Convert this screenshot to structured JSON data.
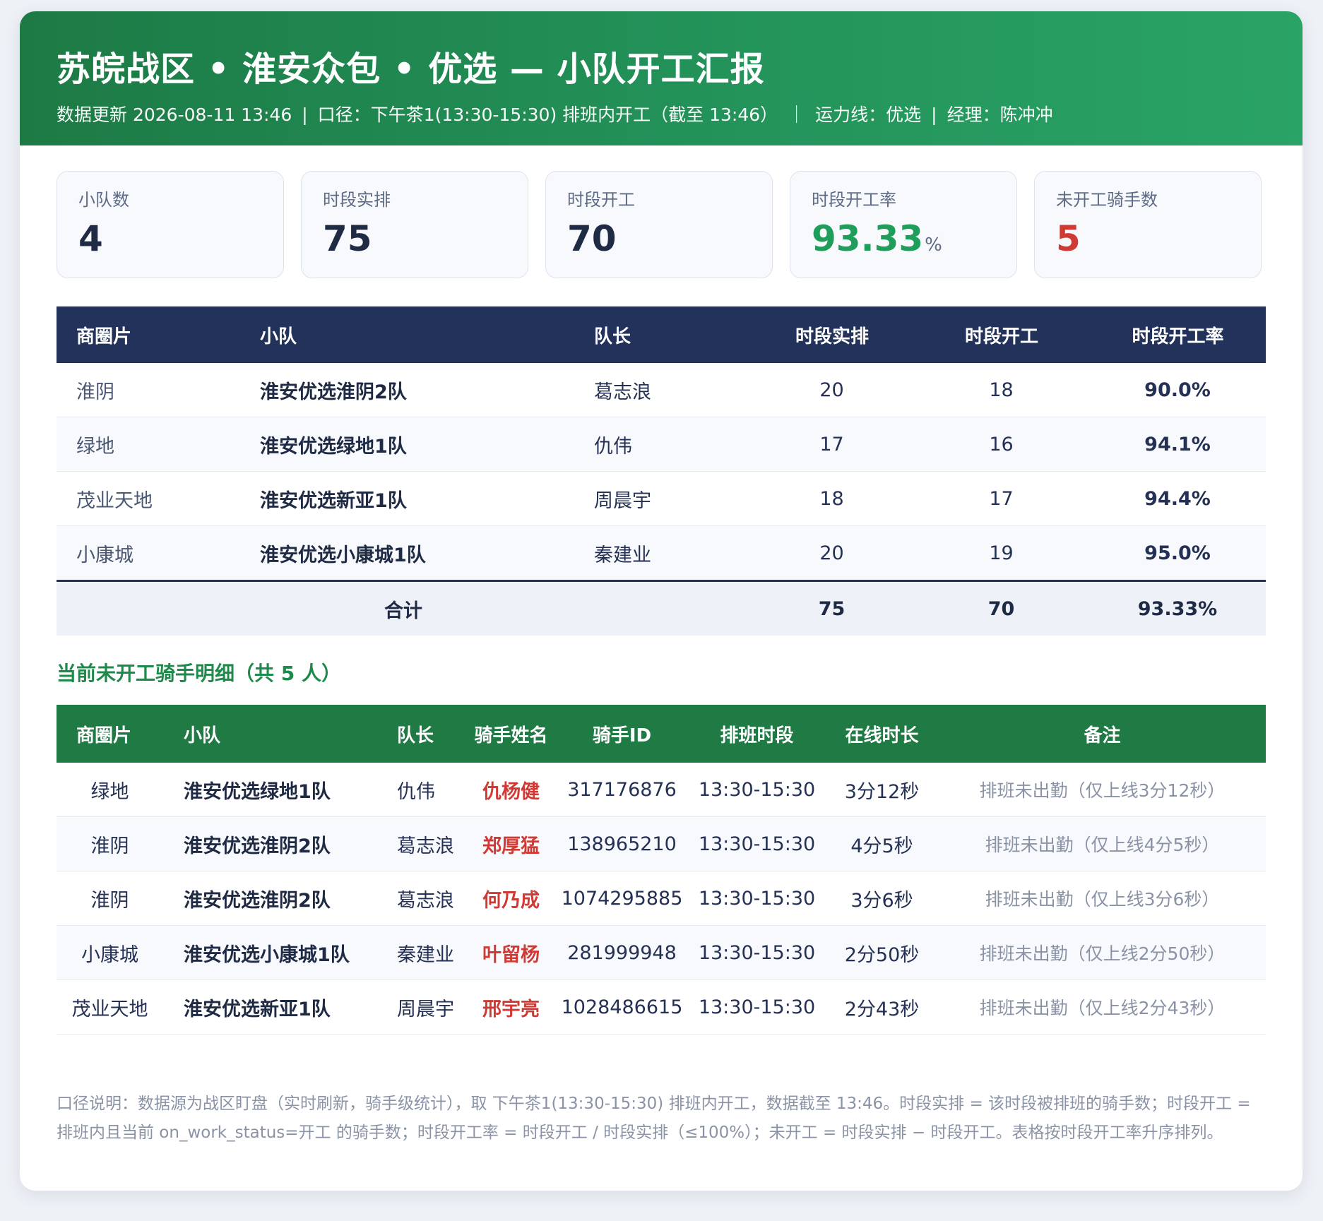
{
  "header": {
    "title": "苏皖战区 • 淮安众包 • 优选 — 小队开工汇报",
    "update": "数据更新 2026-08-11 13:46",
    "caliber": "口径：下午茶1(13:30-15:30) 排班内开工（截至 13:46）",
    "line": "运力线：优选",
    "manager": "经理：陈冲冲",
    "sep1": "|",
    "sep2": "｜",
    "sep3": "|"
  },
  "kpis": {
    "squads": {
      "label": "小队数",
      "value": "4"
    },
    "scheduled": {
      "label": "时段实排",
      "value": "75"
    },
    "started": {
      "label": "时段开工",
      "value": "70"
    },
    "rate": {
      "label": "时段开工率",
      "value": "93.33",
      "unit": "%"
    },
    "not_started": {
      "label": "未开工骑手数",
      "value": "5"
    }
  },
  "summary_table": {
    "headers": [
      "商圈片",
      "小队",
      "队长",
      "时段实排",
      "时段开工",
      "时段开工率"
    ],
    "rows": [
      {
        "region": "淮阴",
        "team": "淮安优选淮阴2队",
        "leader": "葛志浪",
        "scheduled": "20",
        "started": "18",
        "rate": "90.0%"
      },
      {
        "region": "绿地",
        "team": "淮安优选绿地1队",
        "leader": "仇伟",
        "scheduled": "17",
        "started": "16",
        "rate": "94.1%"
      },
      {
        "region": "茂业天地",
        "team": "淮安优选新亚1队",
        "leader": "周晨宇",
        "scheduled": "18",
        "started": "17",
        "rate": "94.4%"
      },
      {
        "region": "小康城",
        "team": "淮安优选小康城1队",
        "leader": "秦建业",
        "scheduled": "20",
        "started": "19",
        "rate": "95.0%"
      }
    ],
    "total": {
      "label": "合计",
      "scheduled": "75",
      "started": "70",
      "rate": "93.33%"
    }
  },
  "detail_title": "当前未开工骑手明细（共 5 人）",
  "detail_table": {
    "headers": [
      "商圈片",
      "小队",
      "队长",
      "骑手姓名",
      "骑手ID",
      "排班时段",
      "在线时长",
      "备注"
    ],
    "rows": [
      {
        "region": "绿地",
        "team": "淮安优选绿地1队",
        "leader": "仇伟",
        "rider": "仇杨健",
        "id": "317176876",
        "slot": "13:30-15:30",
        "online": "3分12秒",
        "note": "排班未出勤（仅上线3分12秒）"
      },
      {
        "region": "淮阴",
        "team": "淮安优选淮阴2队",
        "leader": "葛志浪",
        "rider": "郑厚猛",
        "id": "138965210",
        "slot": "13:30-15:30",
        "online": "4分5秒",
        "note": "排班未出勤（仅上线4分5秒）"
      },
      {
        "region": "淮阴",
        "team": "淮安优选淮阴2队",
        "leader": "葛志浪",
        "rider": "何乃成",
        "id": "1074295885",
        "slot": "13:30-15:30",
        "online": "3分6秒",
        "note": "排班未出勤（仅上线3分6秒）"
      },
      {
        "region": "小康城",
        "team": "淮安优选小康城1队",
        "leader": "秦建业",
        "rider": "叶留杨",
        "id": "281999948",
        "slot": "13:30-15:30",
        "online": "2分50秒",
        "note": "排班未出勤（仅上线2分50秒）"
      },
      {
        "region": "茂业天地",
        "team": "淮安优选新亚1队",
        "leader": "周晨宇",
        "rider": "邢宇亮",
        "id": "1028486615",
        "slot": "13:30-15:30",
        "online": "2分43秒",
        "note": "排班未出勤（仅上线2分43秒）"
      }
    ]
  },
  "footnote": "口径说明：数据源为战区盯盘（实时刷新，骑手级统计），取 下午茶1(13:30-15:30) 排班内开工，数据截至 13:46。时段实排 = 该时段被排班的骑手数；时段开工 = 排班内且当前 on_work_status=开工 的骑手数；时段开工率 = 时段开工 / 时段实排（≤100%）；未开工 = 时段实排 − 时段开工。表格按时段开工率升序排列。",
  "colors": {
    "header_green": "#23935a",
    "table_navy": "#22325a",
    "detail_green": "#1f7a44",
    "rate_red": "#d03a34",
    "rate_orange": "#e08a18",
    "kpi_green": "#1f9d5a"
  }
}
